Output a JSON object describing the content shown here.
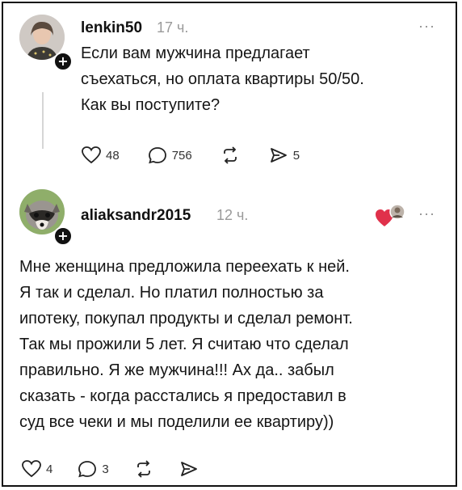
{
  "post1": {
    "username": "lenkin50",
    "time": "17 ч.",
    "text": "Если вам мужчина предлагает\nсъехаться, но оплата квартиры 50/50.\nКак вы поступите?",
    "likes": "48",
    "comments": "756",
    "shares": "5",
    "more": "···"
  },
  "post2": {
    "username": "aliaksandr2015",
    "time": "12 ч.",
    "text": "Мне женщина предложила переехать к ней.\nЯ так и сделал. Но платил полностью за\nипотеку, покупал продукты и сделал ремонт.\nТак мы прожили 5 лет. Я считаю что сделал\nправильно. Я же мужчина!!! Ах да.. забыл\nсказать - когда расстались я предоставил в\nсуд все чеки и мы поделили ее квартиру))",
    "likes": "4",
    "comments": "3",
    "more": "···"
  },
  "icons": {
    "like": "heart-icon",
    "comment": "comment-bubble-icon",
    "repost": "repost-icon",
    "share": "send-icon",
    "plus": "+"
  },
  "colors": {
    "muted": "#9a9a9a",
    "heart": "#e0314b",
    "text": "#111111"
  }
}
